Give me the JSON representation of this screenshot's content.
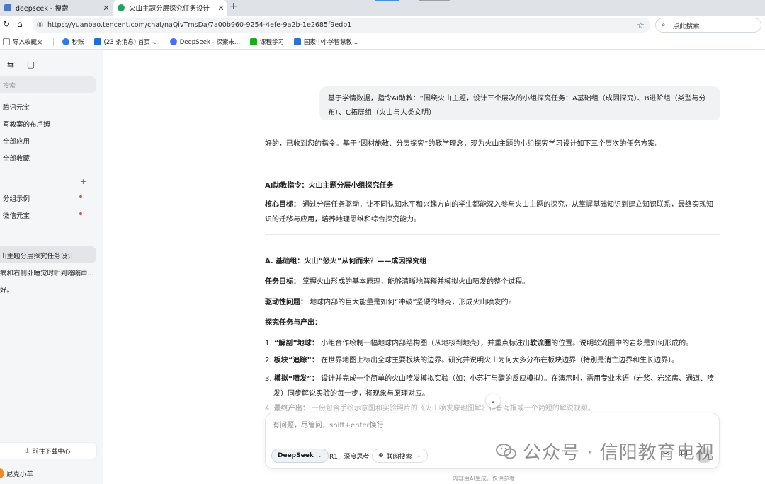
{
  "browser": {
    "tabs": [
      {
        "title": "deepseek - 搜索",
        "favicon_color": "#4a78c2"
      },
      {
        "title": "火山主题分层探究任务设计",
        "favicon_color": "#22a35a"
      }
    ],
    "url": "https://yuanbao.tencent.com/chat/naQivTmsDa/7a00b960-9254-4efe-9a2b-1e2685f9edb1",
    "search_placeholder": "点此搜索",
    "bookmarks": [
      {
        "label": "导入收藏夹",
        "color": "#888888"
      },
      {
        "label": "秒账",
        "color": "#2c7be5"
      },
      {
        "label": "(23 条消息) 首页 -...",
        "color": "#1e6fd9"
      },
      {
        "label": "DeepSeek - 探索未...",
        "color": "#4d6bfe"
      },
      {
        "label": "课程学习",
        "color": "#1aad19"
      },
      {
        "label": "国家中小学智慧教...",
        "color": "#2f6fd6"
      }
    ]
  },
  "sidebar": {
    "search_placeholder": "搜索",
    "items": [
      {
        "label": "腾讯元宝"
      },
      {
        "label": "写教案的布卢姆"
      },
      {
        "label": "全部应用"
      },
      {
        "label": "全部收藏"
      }
    ],
    "group_header": "",
    "group_items": [
      {
        "label": "分组示例"
      },
      {
        "label": "微信元宝"
      }
    ],
    "history": [
      {
        "label": "山主题分层探究任务设计"
      },
      {
        "label": "病和右侧卧睡觉时听到嗡嗡声..."
      },
      {
        "label": "好。"
      }
    ],
    "download_label": "前往下载中心",
    "username": "尼克小羊"
  },
  "chat": {
    "user_message": "基于学情数据，指令AI助教：“围绕火山主题，设计三个层次的小组探究任务：A基础组（成因探究）、B进阶组（类型与分布）、C拓展组（火山与人类文明）",
    "reply_intro": "好的，已收到您的指令。基于“因材施教、分层探究”的教学理念，现为火山主题的小组探究学习设计如下三个层次的任务方案。",
    "instruction_heading": "AI助教指令：火山主题分层小组探究任务",
    "core_goal_label": "核心目标：",
    "core_goal_text": "通过分层任务驱动，让不同认知水平和兴趣方向的学生都能深入参与火山主题的探究，从掌握基础知识到建立知识联系，最终实现知识的迁移与应用，培养地理思维和综合探究能力。",
    "section_a_heading": "A. 基础组：火山“怒火”从何而来？——成因探究组",
    "task_goal_label": "任务目标：",
    "task_goal_text": "掌握火山形成的基本原理，能够清晰地解释并模拟火山喷发的整个过程。",
    "driving_q_label": "驱动性问题：",
    "driving_q_text": "地球内部的巨大能量是如何“冲破”坚硬的地壳，形成火山喷发的？",
    "tasks_heading": "探究任务与产出：",
    "task1_label": "“解剖”地球：",
    "task1_text_a": "小组合作绘制一幅地球内部结构图（从地核到地壳），并重点标注出",
    "task1_bold": "软流圈",
    "task1_text_b": "的位置。说明软流圈中的岩浆是如何形成的。",
    "task2_label": "板块“追踪”：",
    "task2_text": "在世界地图上标出全球主要板块的边界。研究并说明火山为何大多分布在板块边界（特别是消亡边界和生长边界）。",
    "task3_label": "模拟“喷发”：",
    "task3_text": "设计并完成一个简单的火山喷发模拟实验（如：小苏打与醋的反应模拟）。在演示时，需用专业术语（岩浆、岩浆房、通道、喷发）同步解说实验的每一步，将现象与原理对应。",
    "task4_label": "最终产出：",
    "task4_text": "一份包含手绘示意图和实验照片的《火山喷发原理图解》科普海报或一个简短的解说视频。"
  },
  "composer": {
    "placeholder": "有问题，尽管问，shift+enter换行",
    "model_chip": "DeepSeek",
    "r1_chip": "R1 · 深度思考",
    "web_chip": "联网搜索",
    "disclaimer": "内容由AI生成，仅供参考"
  },
  "watermark": "公众号 · 信阳教育电视"
}
